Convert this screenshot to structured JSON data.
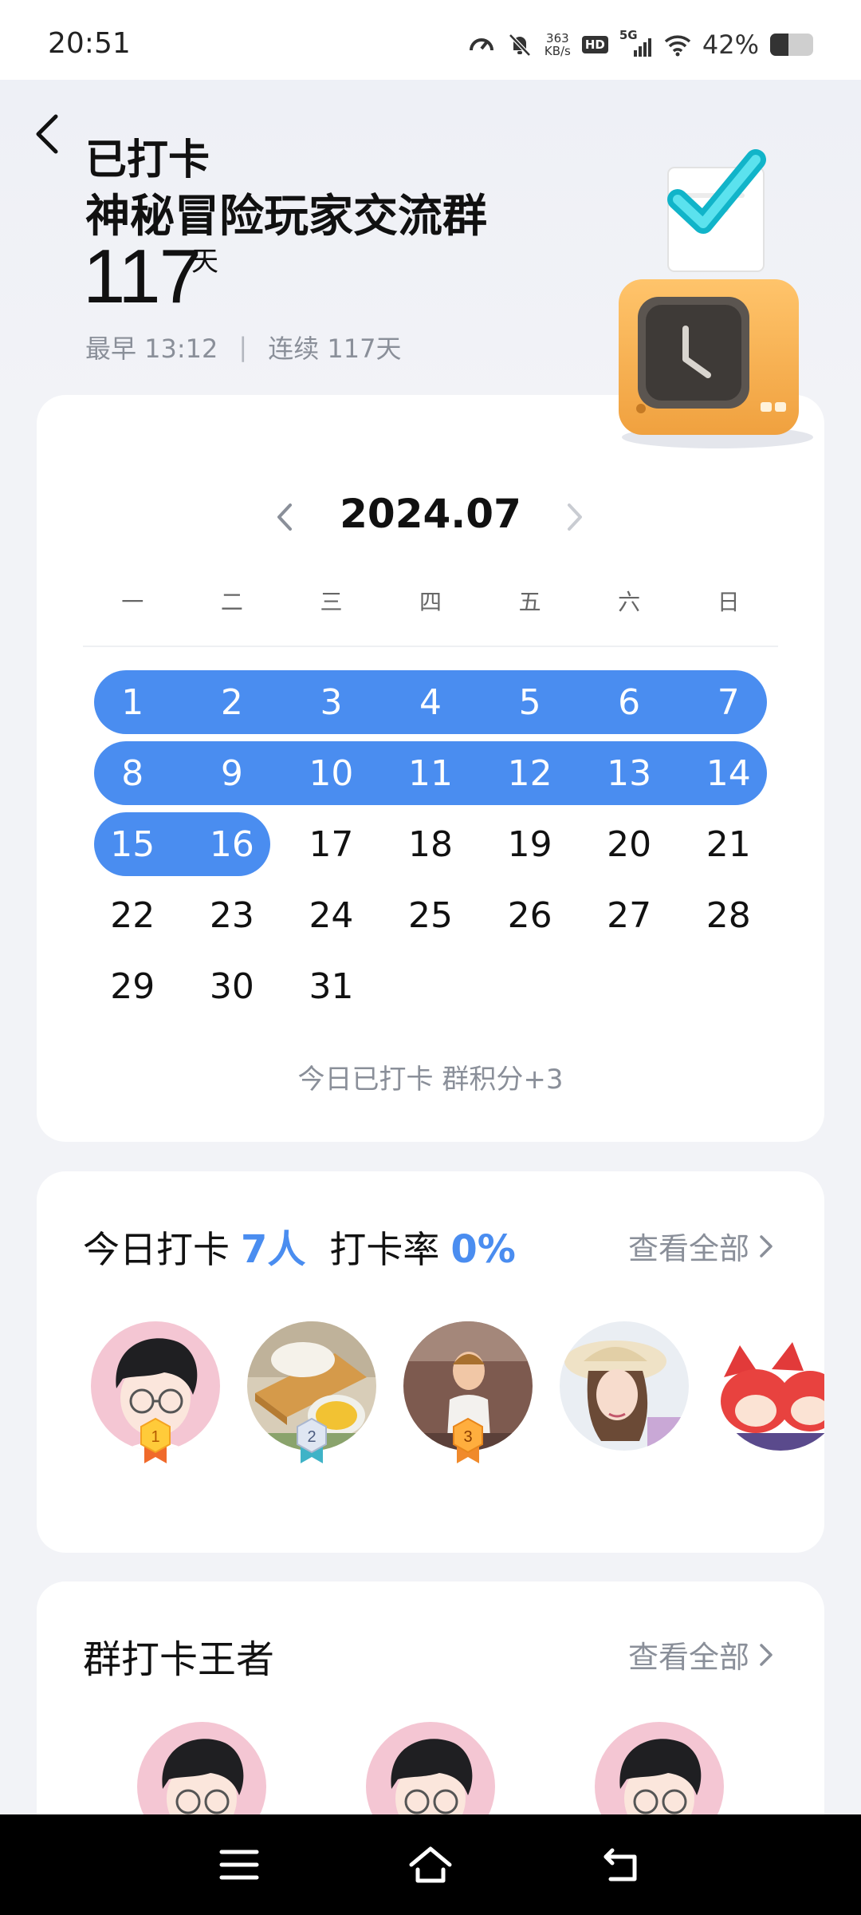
{
  "status_bar": {
    "time": "20:51",
    "net_speed_value": "363",
    "net_speed_unit": "KB/s",
    "hd": "HD",
    "network": "5G",
    "battery_text": "42%",
    "battery_level": 0.42
  },
  "header": {
    "title": "已打卡",
    "group_name": "神秘冒险玩家交流群",
    "days_count": "117",
    "days_unit": "天",
    "earliest": "最早 13:12",
    "separator": "|",
    "streak": "连续 117天"
  },
  "calendar": {
    "month": "2024.07",
    "weekdays": [
      "一",
      "二",
      "三",
      "四",
      "五",
      "六",
      "日"
    ],
    "rows": [
      [
        "1",
        "2",
        "3",
        "4",
        "5",
        "6",
        "7"
      ],
      [
        "8",
        "9",
        "10",
        "11",
        "12",
        "13",
        "14"
      ],
      [
        "15",
        "16",
        "17",
        "18",
        "19",
        "20",
        "21"
      ],
      [
        "22",
        "23",
        "24",
        "25",
        "26",
        "27",
        "28"
      ],
      [
        "29",
        "30",
        "31"
      ]
    ],
    "checked_days": [
      1,
      2,
      3,
      4,
      5,
      6,
      7,
      8,
      9,
      10,
      11,
      12,
      13,
      14,
      15,
      16
    ],
    "footer": "今日已打卡  群积分+3",
    "accent_color": "#4a8df0"
  },
  "today": {
    "label": "今日打卡",
    "count": "7人",
    "rate_label": "打卡率",
    "rate": "0%",
    "view_all": "查看全部",
    "medal_ranks": [
      "1",
      "2",
      "3"
    ]
  },
  "king": {
    "title": "群打卡王者",
    "view_all": "查看全部"
  }
}
